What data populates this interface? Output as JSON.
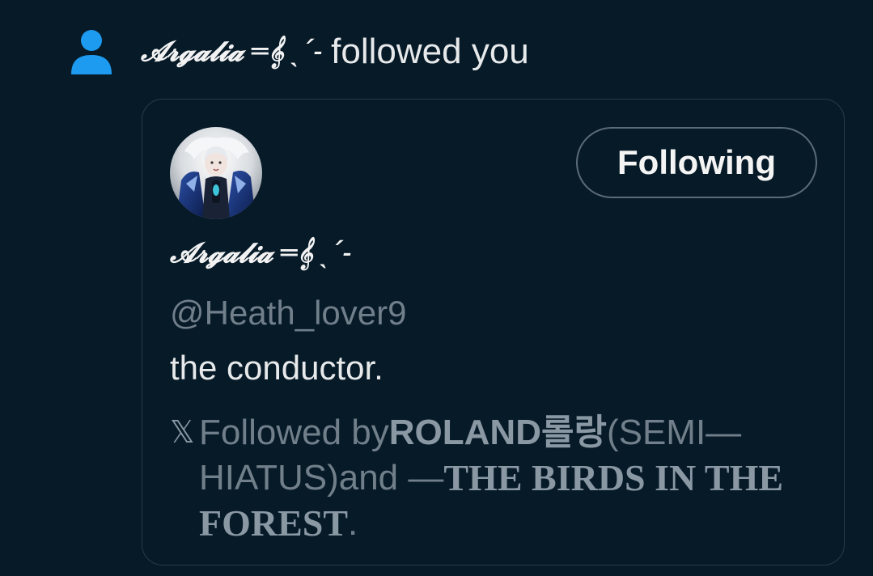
{
  "notification": {
    "icon": "person-icon",
    "actor_name": "𝓐𝓻𝓰𝓪𝓵𝓲𝓪 ═𝄞 ˎˊ˗",
    "action_text": "followed you"
  },
  "card": {
    "avatar": "avatar-image",
    "follow_button_label": "Following",
    "display_name": "𝓐𝓻𝓰𝓪𝓵𝓲𝓪 ═𝄞 ˎˊ˗",
    "handle": "@Heath_lover9",
    "bio": "the conductor.",
    "followed_by": {
      "icon": "x-logo-icon",
      "prefix": "Followed by ",
      "user1_name": "ROLAND롤랑",
      "user1_suffix_line1": " (SEMI—",
      "user1_suffix_line2": "HIATUS)",
      "connector": " and — ",
      "user2_name_line1": "THE BIRDS IN THE",
      "user2_name_line2": "FOREST",
      "end": "."
    }
  },
  "colors": {
    "background": "#061a28",
    "accent_blue": "#1d9bf0",
    "muted_text": "#717f8a",
    "card_border": "#2a3b48"
  }
}
